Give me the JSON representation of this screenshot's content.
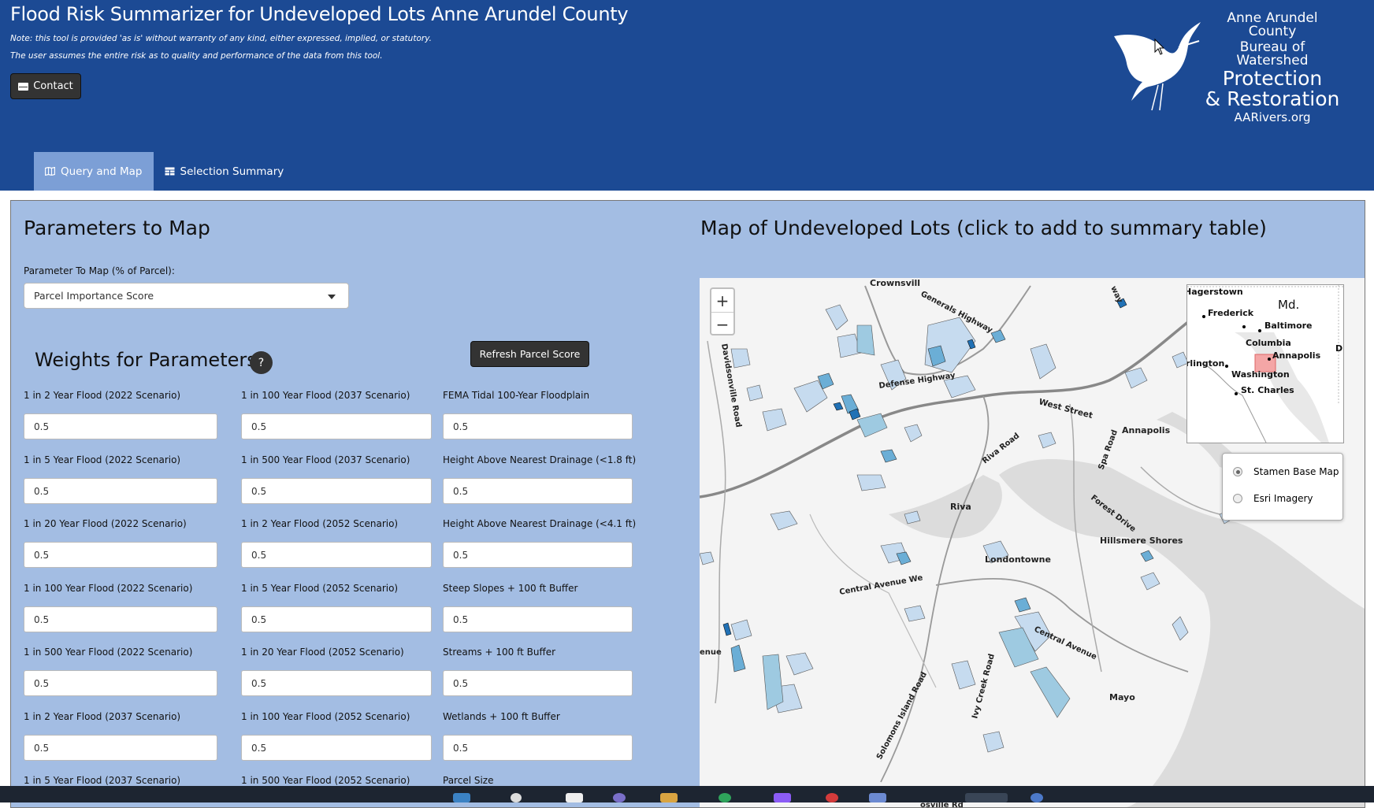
{
  "header": {
    "title": "Flood Risk Summarizer for Undeveloped Lots Anne Arundel County",
    "disclaimer_1": "Note: this tool is provided 'as is' without warranty of any kind, either expressed, implied, or statutory.",
    "disclaimer_2": "The user assumes the entire risk as to quality and performance of the data from this tool.",
    "contact_label": "Contact",
    "logo": {
      "line1": "Anne Arundel County",
      "line2": "Bureau of Watershed",
      "line3": "Protection",
      "line4": "& Restoration",
      "line5": "AARivers.org"
    }
  },
  "tabs": [
    {
      "label": "Query and Map",
      "icon": "map-icon",
      "active": true
    },
    {
      "label": "Selection Summary",
      "icon": "table-icon",
      "active": false
    }
  ],
  "params": {
    "title": "Parameters to Map",
    "select_label": "Parameter To Map (% of Parcel):",
    "select_value": "Parcel Importance Score"
  },
  "weights": {
    "title": "Weights for Parameters",
    "help": "?",
    "refresh_label": "Refresh Parcel Score",
    "col1": [
      {
        "label": "1 in 2 Year Flood (2022 Scenario)",
        "value": "0.5"
      },
      {
        "label": "1 in 5 Year Flood (2022 Scenario)",
        "value": "0.5"
      },
      {
        "label": "1 in 20 Year Flood (2022 Scenario)",
        "value": "0.5"
      },
      {
        "label": "1 in 100 Year Flood (2022 Scenario)",
        "value": "0.5"
      },
      {
        "label": "1 in 500 Year Flood (2022 Scenario)",
        "value": "0.5"
      },
      {
        "label": "1 in 2 Year Flood (2037 Scenario)",
        "value": "0.5"
      },
      {
        "label": "1 in 5 Year Flood (2037 Scenario)",
        "value": ""
      }
    ],
    "col2": [
      {
        "label": "1 in 100 Year Flood (2037 Scenario)",
        "value": "0.5"
      },
      {
        "label": "1 in 500 Year Flood (2037 Scenario)",
        "value": "0.5"
      },
      {
        "label": "1 in 2 Year Flood (2052 Scenario)",
        "value": "0.5"
      },
      {
        "label": "1 in 5 Year Flood (2052 Scenario)",
        "value": "0.5"
      },
      {
        "label": "1 in 20 Year Flood (2052 Scenario)",
        "value": "0.5"
      },
      {
        "label": "1 in 100 Year Flood (2052 Scenario)",
        "value": "0.5"
      },
      {
        "label": "1 in 500 Year Flood (2052 Scenario)",
        "value": ""
      }
    ],
    "col3": [
      {
        "label": "FEMA Tidal 100-Year Floodplain",
        "value": "0.5"
      },
      {
        "label": "Height Above Nearest Drainage (<1.8 ft)",
        "value": "0.5"
      },
      {
        "label": "Height Above Nearest Drainage (<4.1 ft)",
        "value": "0.5"
      },
      {
        "label": "Steep Slopes + 100 ft Buffer",
        "value": "0.5"
      },
      {
        "label": "Streams + 100 ft Buffer",
        "value": "0.5"
      },
      {
        "label": "Wetlands + 100 ft Buffer",
        "value": "0.5"
      },
      {
        "label": "Parcel Size",
        "value": ""
      }
    ]
  },
  "map": {
    "title": "Map of Undeveloped Lots (click to add to summary table)",
    "zoom_in": "+",
    "zoom_out": "−",
    "place_labels": [
      "Crownsvill",
      "Generals Highway",
      "Davidsonville Road",
      "Defense Highway",
      "West Street",
      "Annapolis",
      "Riva Road",
      "Spa Road",
      "Riva",
      "Forest Drive",
      "Hillsmere Shores",
      "Londontowne",
      "Central Avenue We",
      "Central Avenue",
      "enue",
      "Mayo",
      "Solomons Island Road",
      "Ivy Creek Road",
      "osville Rd",
      "way"
    ],
    "minimap_labels": [
      "Hagerstown",
      "Frederick",
      "Md.",
      "Baltimore",
      "Columbia",
      "Annapolis",
      "rlington",
      "Washington",
      "St. Charles",
      "D"
    ],
    "layers": [
      {
        "label": "Stamen Base Map",
        "selected": true
      },
      {
        "label": "Esri Imagery",
        "selected": false
      }
    ]
  },
  "colors": {
    "header_bg": "#1c4a94",
    "tab_active": "#7c9fd6",
    "panel_bg": "#a3bde3",
    "parcel_light": "#c6dbef",
    "parcel_mid": "#6baed6",
    "parcel_dark": "#2171b5"
  }
}
